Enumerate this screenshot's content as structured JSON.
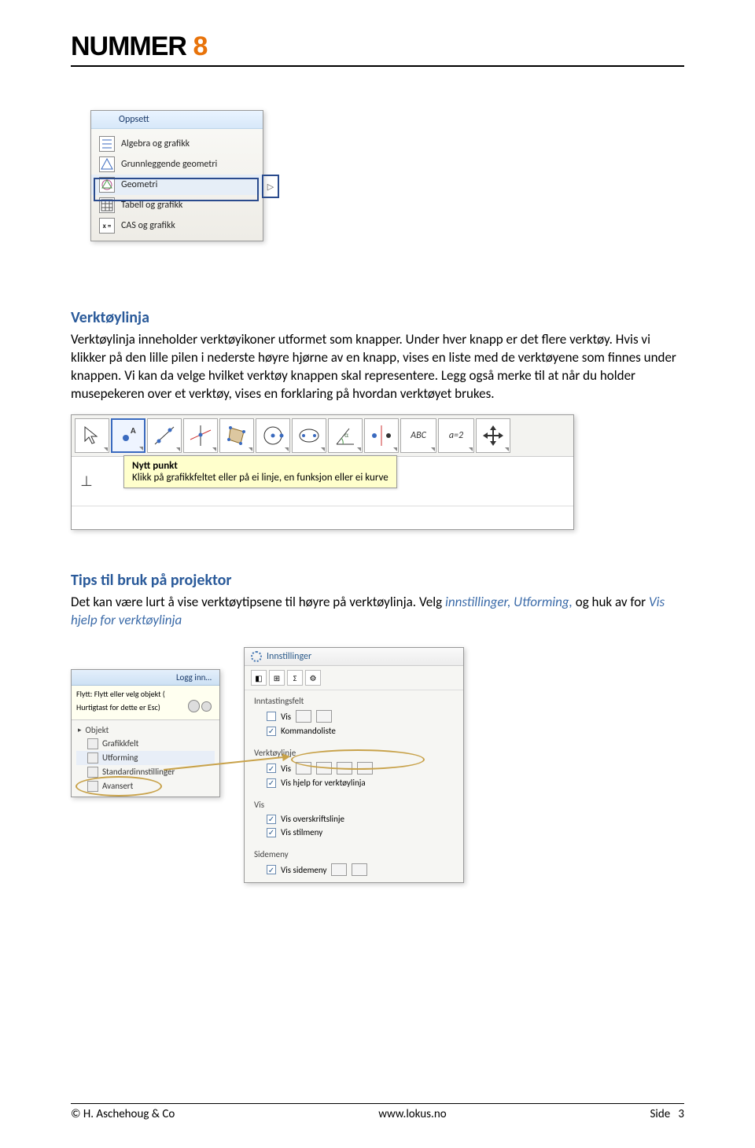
{
  "logo": {
    "text": "NUMMER ",
    "accent": "8"
  },
  "menu1": {
    "header": "Oppsett",
    "items": [
      {
        "label": "Algebra og grafikk",
        "icon": "list"
      },
      {
        "label": "Grunnleggende geometri",
        "icon": "tri"
      },
      {
        "label": "Geometri",
        "icon": "geom"
      },
      {
        "label": "Tabell og grafikk",
        "icon": "grid"
      },
      {
        "label": "CAS og grafikk",
        "icon": "cas"
      }
    ],
    "expander": "▷"
  },
  "section1": {
    "heading": "Verktøylinja",
    "text": "Verktøylinja inneholder verktøyikoner utformet som knapper. Under hver knapp er det flere verktøy. Hvis vi klikker på den lille pilen i nederste høyre hjørne av en knapp, vises en liste med de verktøyene som finnes under knappen. Vi kan da velge hvilket verktøy knappen skal representere. Legg også merke til at når du holder musepekeren over et verktøy, vises en forklaring på hvordan verktøyet brukes."
  },
  "toolbar2": {
    "abc": "ABC",
    "a2": "a=2",
    "tipTitle": "Nytt punkt",
    "tipBody": "Klikk på grafikkfeltet eller på ei linje, en funksjon eller ei kurve"
  },
  "section2": {
    "heading": "Tips til bruk på projektor",
    "text_a": "Det kan være lurt å vise verktøytipsene til høyre på verktøylinja. Velg ",
    "ital1": "innstillinger,",
    "ital2": "Utforming,",
    "text_b": " og huk av for ",
    "ital3": "Vis hjelp for verktøylinja"
  },
  "shot3a": {
    "loginHeader": "Logg inn…",
    "flytt_l1": "Flytt: Flytt eller velg objekt (",
    "flytt_l2": "Hurtigtast for dette er Esc)",
    "treeHeader": "Objekt",
    "tree": [
      "Grafikkfelt",
      "Utforming",
      "Standardinnstillinger",
      "Avansert"
    ]
  },
  "shot3b": {
    "title": "Innstillinger",
    "s1": {
      "label": "Inntastingsfelt",
      "r1": "Vis",
      "r2": "Kommandoliste"
    },
    "s2": {
      "label": "Verktøylinje",
      "r1": "Vis",
      "r2": "Vis hjelp for verktøylinja"
    },
    "s3": {
      "label": "Vis",
      "r1": "Vis overskriftslinje",
      "r2": "Vis stilmeny"
    },
    "s4": {
      "label": "Sidemeny",
      "r1": "Vis sidemeny"
    }
  },
  "footer": {
    "left": "© H. Aschehoug & Co",
    "center": "www.lokus.no",
    "right_a": "Side",
    "right_b": "3"
  }
}
